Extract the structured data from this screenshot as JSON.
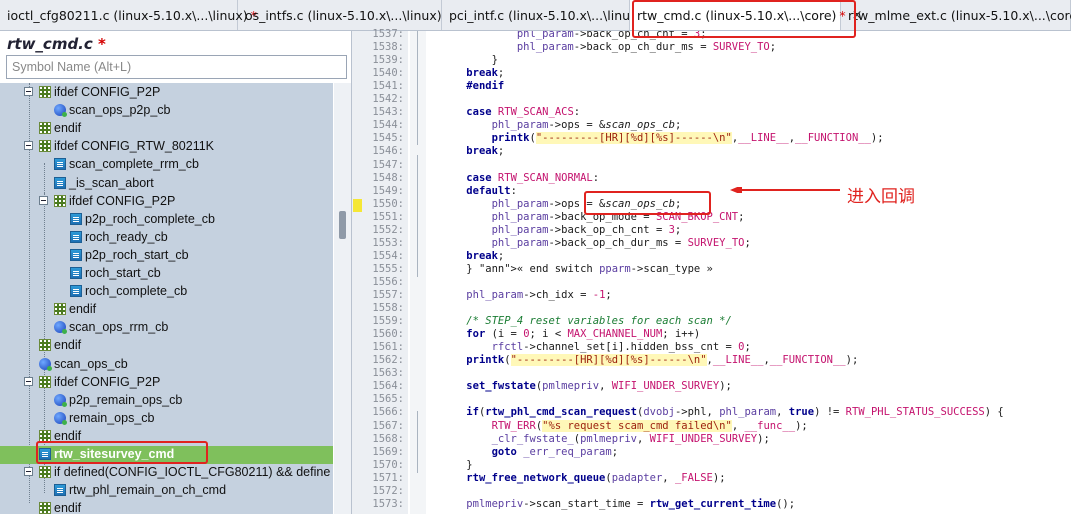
{
  "tabs": [
    {
      "label": "ioctl_cfg80211.c (linux-5.10.x\\...\\linux)",
      "modified": "*",
      "close": ""
    },
    {
      "label": "os_intfs.c (linux-5.10.x\\...\\linux)",
      "modified": "",
      "close": ""
    },
    {
      "label": "pci_intf.c (linux-5.10.x\\...\\linux)",
      "modified": "",
      "close": ""
    },
    {
      "label": "rtw_cmd.c (linux-5.10.x\\...\\core)",
      "modified": "*",
      "close": "×"
    },
    {
      "label": "rtw_mlme_ext.c (linux-5.10.x\\...\\core)",
      "modified": "",
      "close": ""
    }
  ],
  "file_title": "rtw_cmd.c",
  "file_modified": "*",
  "symbol_search": {
    "placeholder": "Symbol Name (Alt+L)",
    "value": ""
  },
  "tree": [
    {
      "label": "ifdef CONFIG_P2P",
      "icon": "hash-icon",
      "level": 1,
      "toggle": true
    },
    {
      "label": "scan_ops_p2p_cb",
      "icon": "variable-icon",
      "level": 2
    },
    {
      "label": "endif",
      "icon": "hash-icon",
      "level": 1
    },
    {
      "label": "ifdef CONFIG_RTW_80211K",
      "icon": "hash-icon",
      "level": 1,
      "toggle": true
    },
    {
      "label": "scan_complete_rrm_cb",
      "icon": "function-icon",
      "level": 2
    },
    {
      "label": "_is_scan_abort",
      "icon": "function-icon",
      "level": 2
    },
    {
      "label": "ifdef CONFIG_P2P",
      "icon": "hash-icon",
      "level": 2,
      "toggle": true
    },
    {
      "label": "p2p_roch_complete_cb",
      "icon": "function-icon",
      "level": 3
    },
    {
      "label": "roch_ready_cb",
      "icon": "function-icon",
      "level": 3
    },
    {
      "label": "p2p_roch_start_cb",
      "icon": "function-icon",
      "level": 3
    },
    {
      "label": "roch_start_cb",
      "icon": "function-icon",
      "level": 3
    },
    {
      "label": "roch_complete_cb",
      "icon": "function-icon",
      "level": 3
    },
    {
      "label": "endif",
      "icon": "hash-icon",
      "level": 2
    },
    {
      "label": "scan_ops_rrm_cb",
      "icon": "variable-icon",
      "level": 2
    },
    {
      "label": "endif",
      "icon": "hash-icon",
      "level": 1
    },
    {
      "label": "scan_ops_cb",
      "icon": "variable-icon",
      "level": 1
    },
    {
      "label": "ifdef CONFIG_P2P",
      "icon": "hash-icon",
      "level": 1,
      "toggle": true
    },
    {
      "label": "p2p_remain_ops_cb",
      "icon": "variable-icon",
      "level": 2
    },
    {
      "label": "remain_ops_cb",
      "icon": "variable-icon",
      "level": 2
    },
    {
      "label": "endif",
      "icon": "hash-icon",
      "level": 1
    },
    {
      "label": "rtw_sitesurvey_cmd",
      "icon": "function-icon",
      "level": 1,
      "selected": true
    },
    {
      "label": "if defined(CONFIG_IOCTL_CFG80211) && define",
      "icon": "hash-icon",
      "level": 1,
      "toggle": true
    },
    {
      "label": "rtw_phl_remain_on_ch_cmd",
      "icon": "function-icon",
      "level": 2
    },
    {
      "label": "endif",
      "icon": "hash-icon",
      "level": 1
    }
  ],
  "line_numbers": [
    "1537:",
    "1538:",
    "1539:",
    "1540:",
    "1541:",
    "1542:",
    "1543:",
    "1544:",
    "1545:",
    "1546:",
    "1547:",
    "1548:",
    "1549:",
    "1550:",
    "1551:",
    "1552:",
    "1553:",
    "1554:",
    "1555:",
    "1556:",
    "1557:",
    "1558:",
    "1559:",
    "1560:",
    "1561:",
    "1562:",
    "1563:",
    "1564:",
    "1565:",
    "1566:",
    "1567:",
    "1568:",
    "1569:",
    "1570:",
    "1571:",
    "1572:",
    "1573:"
  ],
  "code_lines": [
    "            phl_param->back_op_ch_cnt = 3;",
    "            phl_param->back_op_ch_dur_ms = SURVEY_TO;",
    "        }",
    "    break;",
    "    #endif",
    "",
    "    case RTW_SCAN_ACS:",
    "        phl_param->ops = &scan_ops_cb;",
    "        printk(\"---------[HR][%d][%s]------\\n\",__LINE__,__FUNCTION__);",
    "    break;",
    "",
    "    case RTW_SCAN_NORMAL:",
    "    default:",
    "        phl_param->ops = &scan_ops_cb;",
    "        phl_param->back_op_mode = SCAN_BKOP_CNT;",
    "        phl_param->back_op_ch_cnt = 3;",
    "        phl_param->back_op_ch_dur_ms = SURVEY_TO;",
    "    break;",
    "    } « end switch pparm->scan_type »",
    "",
    "    phl_param->ch_idx = -1;",
    "",
    "    /* STEP_4 reset variables for each scan */",
    "    for (i = 0; i < MAX_CHANNEL_NUM; i++)",
    "        rfctl->channel_set[i].hidden_bss_cnt = 0;",
    "    printk(\"---------[HR][%d][%s]------\\n\",__LINE__,__FUNCTION__);",
    "",
    "    set_fwstate(pmlmepriv, WIFI_UNDER_SURVEY);",
    "",
    "    if(rtw_phl_cmd_scan_request(dvobj->phl, phl_param, true) != RTW_PHL_STATUS_SUCCESS) {",
    "        RTW_ERR(\"%s request scam_cmd failed\\n\", __func__);",
    "        _clr_fwstate_(pmlmepriv, WIFI_UNDER_SURVEY);",
    "        goto _err_req_param;",
    "    }",
    "    rtw_free_network_queue(padapter, _FALSE);",
    "",
    "    pmlmepriv->scan_start_time = rtw_get_current_time();"
  ],
  "annotation": "进入回调",
  "colors": {
    "annotation_red": "#e0231f",
    "selected_row": "#7fc05c",
    "tree_bg": "#c5d1df",
    "keyword": "#00008b"
  }
}
